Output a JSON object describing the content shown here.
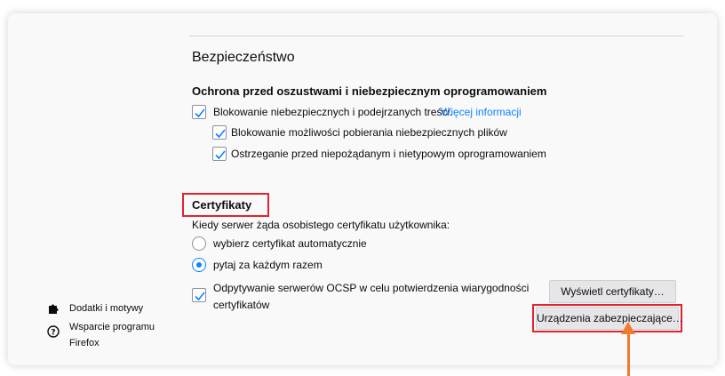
{
  "security": {
    "section_title": "Bezpieczeństwo",
    "protection_heading": "Ochrona przed oszustwami i niebezpiecznym oprogramowaniem",
    "block_dangerous": {
      "label": "Blokowanie niebezpiecznych i podejrzanych treści.",
      "link": "Więcej informacji",
      "checked": true
    },
    "block_downloads": {
      "label": "Blokowanie możliwości pobierania niebezpiecznych plików",
      "checked": true
    },
    "warn_unwanted": {
      "label": "Ostrzeganie przed niepożądanym i nietypowym oprogramowaniem",
      "checked": true
    }
  },
  "certificates": {
    "heading": "Certyfikaty",
    "prompt": "Kiedy serwer żąda osobistego certyfikatu użytkownika:",
    "options": [
      {
        "label": "wybierz certyfikat automatycznie",
        "selected": false
      },
      {
        "label": "pytaj za każdym razem",
        "selected": true
      }
    ],
    "ocsp": {
      "label_line1": "Odpytywanie serwerów OCSP w celu potwierdzenia wiarygodności",
      "label_line2": "certyfikatów",
      "checked": true
    },
    "view_button": "Wyświetl certyfikaty…",
    "devices_button": "Urządzenia zabezpieczające…"
  },
  "sidebar": {
    "addons": {
      "label": "Dodatki i motywy",
      "icon": "puzzle-icon"
    },
    "support": {
      "label_line1": "Wsparcie programu",
      "label_line2": "Firefox",
      "icon": "help-icon"
    }
  },
  "colors": {
    "accent": "#0a84ff",
    "highlight": "#e3232f",
    "arrow": "#f07a2e"
  }
}
